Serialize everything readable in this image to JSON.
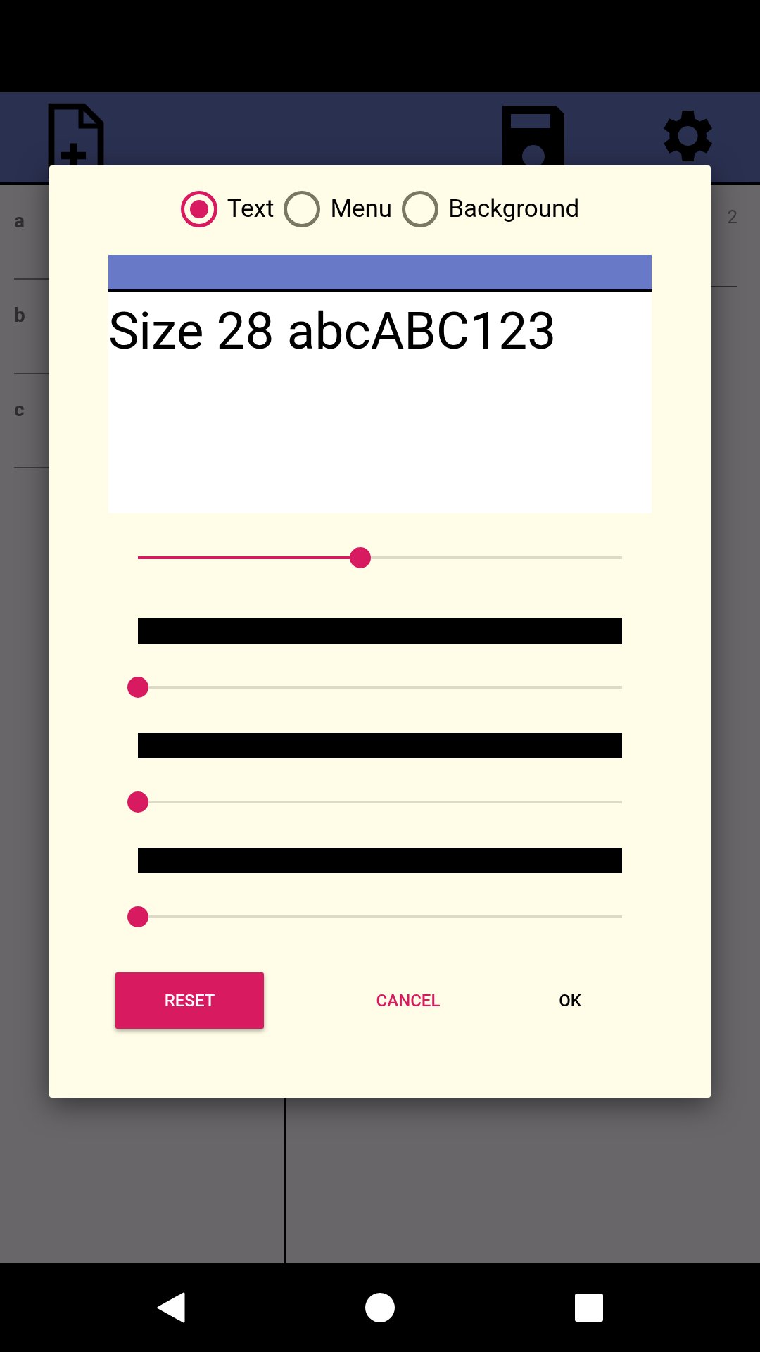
{
  "background": {
    "row_labels": [
      "a",
      "b",
      "c"
    ],
    "column_label": "2"
  },
  "dialog": {
    "targets": [
      {
        "label": "Text",
        "selected": true
      },
      {
        "label": "Menu",
        "selected": false
      },
      {
        "label": "Background",
        "selected": false
      }
    ],
    "preview": {
      "color": "#6779c7",
      "sample": "Size 28 abcABC123"
    },
    "size_slider": {
      "level": 0.46
    },
    "channels": [
      {
        "color": "#000000",
        "level": 0
      },
      {
        "color": "#000000",
        "level": 0
      },
      {
        "color": "#000000",
        "level": 0
      }
    ],
    "buttons": {
      "reset": "RESET",
      "cancel": "CANCEL",
      "ok": "OK"
    }
  }
}
